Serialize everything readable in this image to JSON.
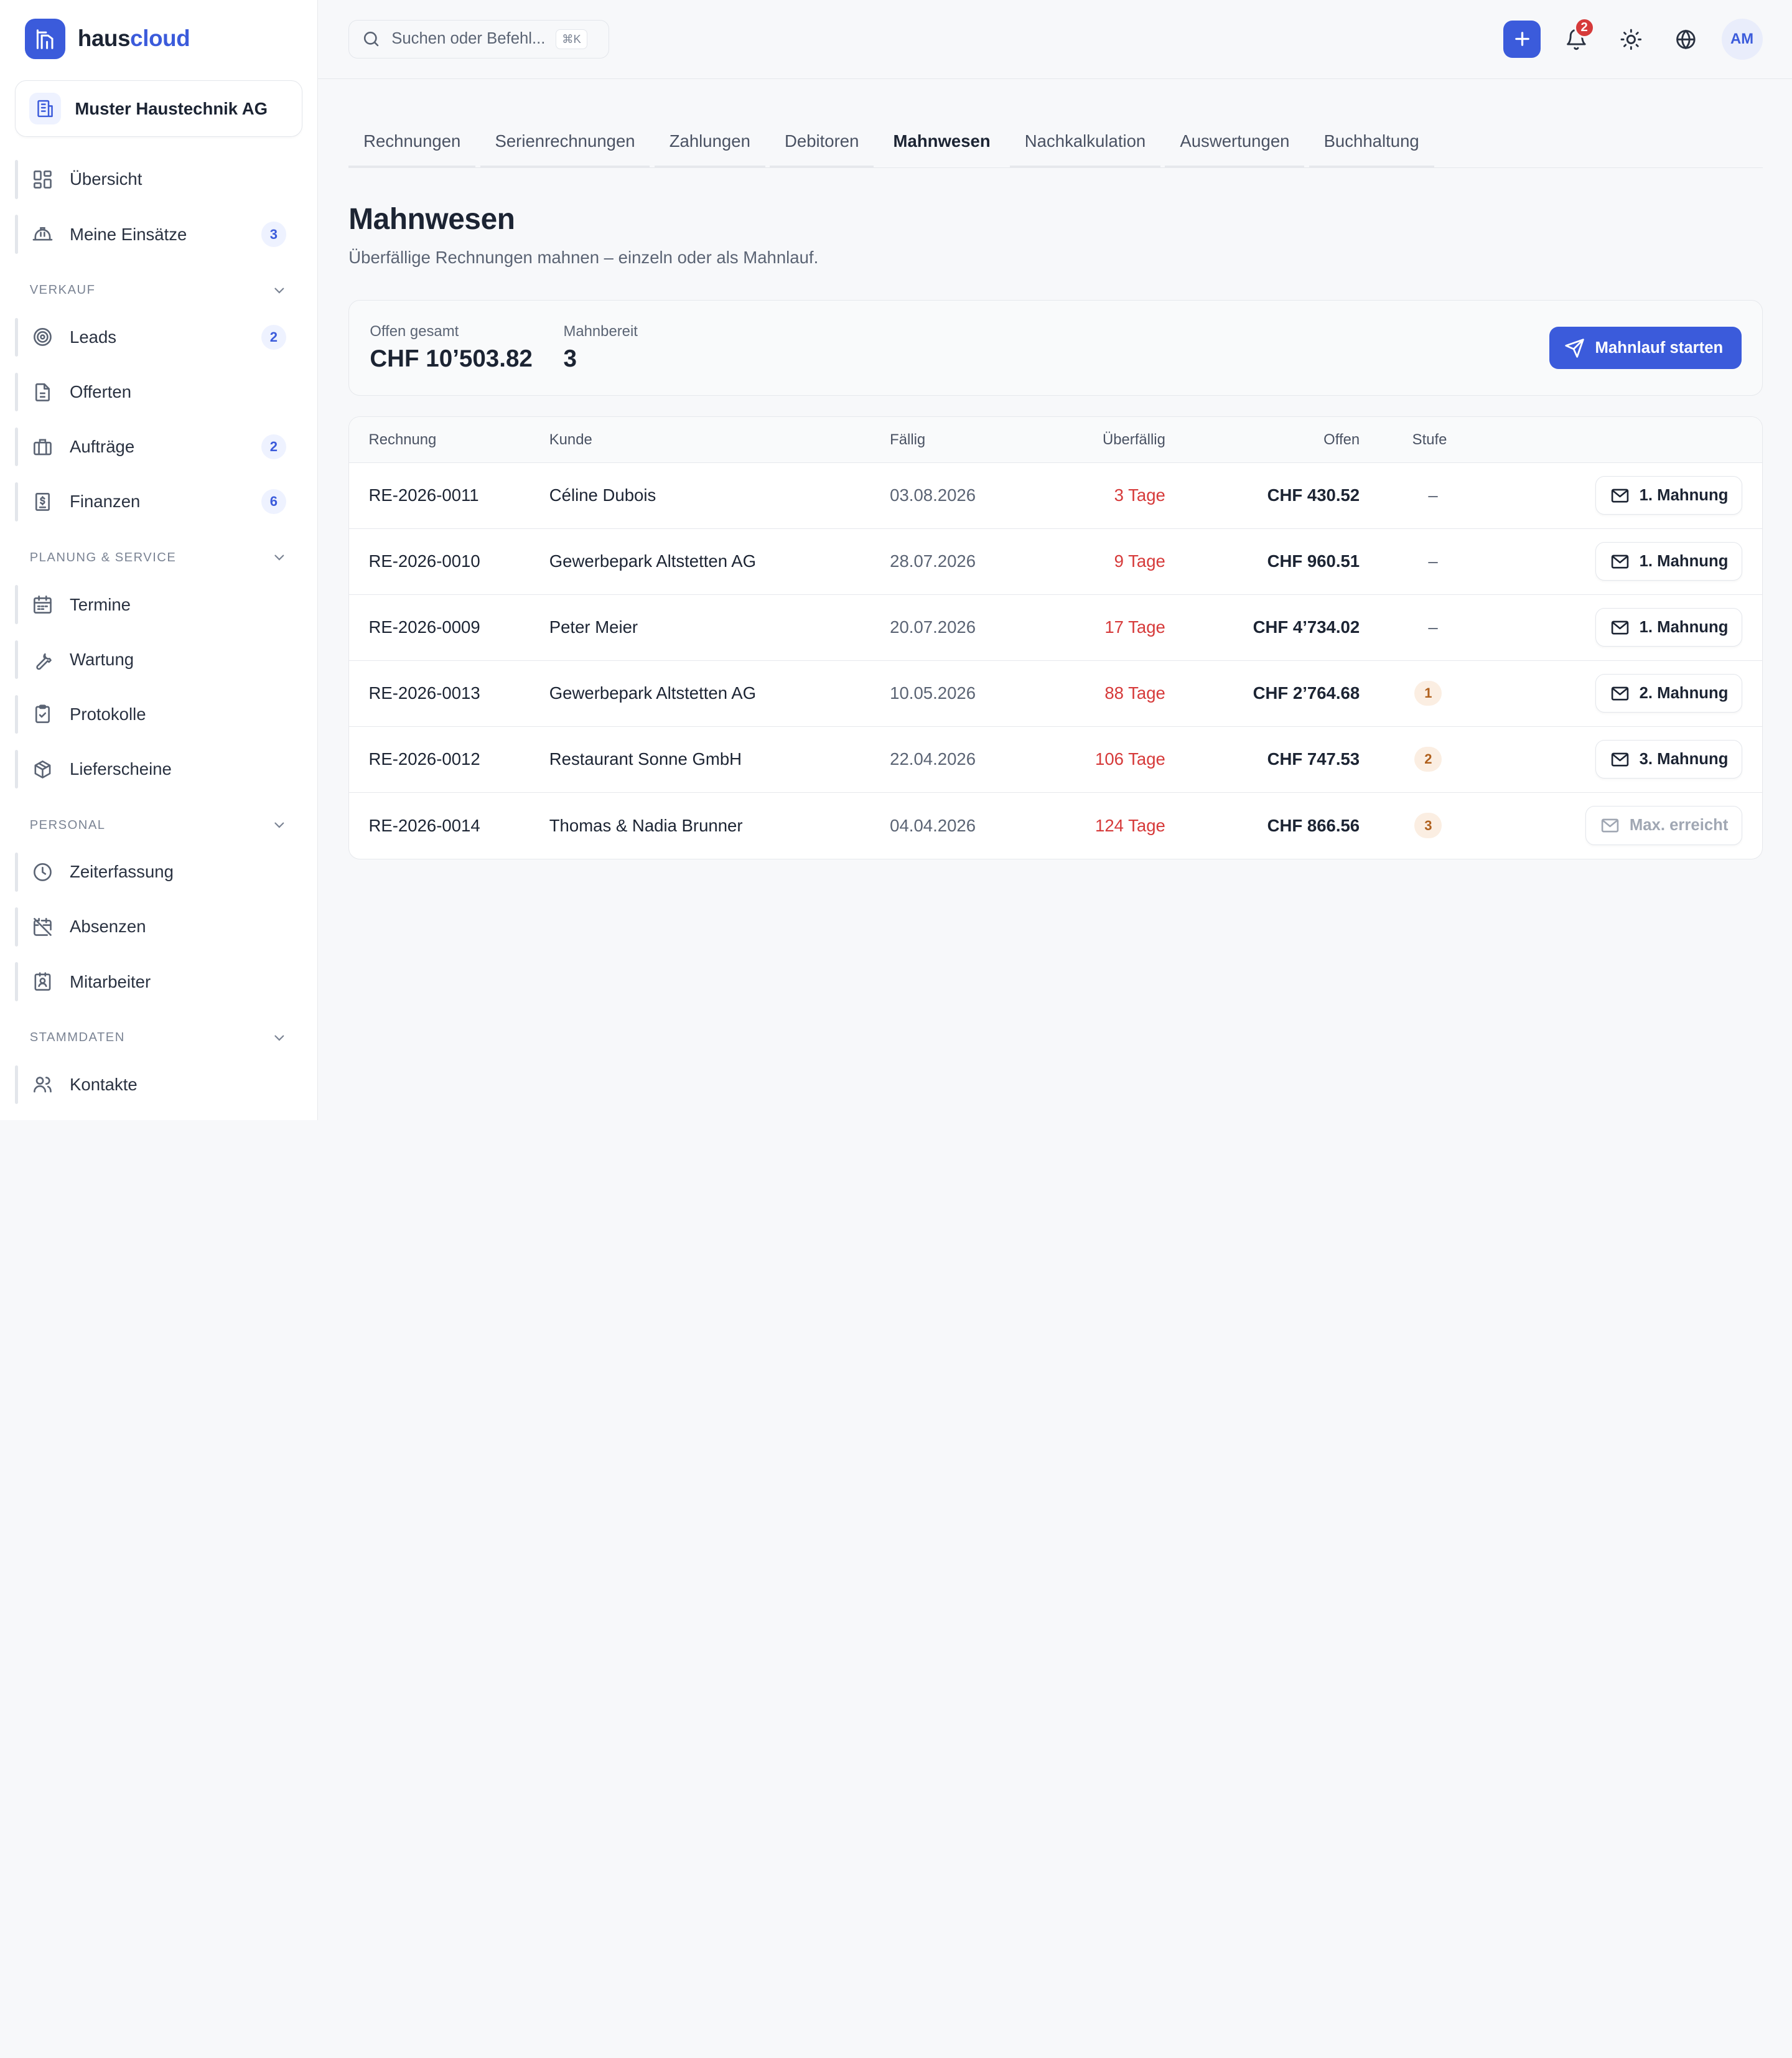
{
  "brand": {
    "part1": "haus",
    "part2": "cloud"
  },
  "company": {
    "name": "Muster Haustechnik AG"
  },
  "sidebar": {
    "top_items": [
      {
        "label": "Übersicht",
        "icon": "dashboard-icon"
      },
      {
        "label": "Meine Einsätze",
        "icon": "hardhat-icon",
        "count": "3"
      }
    ],
    "sections": [
      {
        "title": "VERKAUF",
        "items": [
          {
            "label": "Leads",
            "icon": "target-icon",
            "count": "2"
          },
          {
            "label": "Offerten",
            "icon": "document-icon"
          },
          {
            "label": "Aufträge",
            "icon": "briefcase-icon",
            "count": "2"
          },
          {
            "label": "Finanzen",
            "icon": "invoice-icon",
            "count": "6"
          }
        ]
      },
      {
        "title": "PLANUNG & SERVICE",
        "items": [
          {
            "label": "Termine",
            "icon": "calendar-icon"
          },
          {
            "label": "Wartung",
            "icon": "wrench-icon"
          },
          {
            "label": "Protokolle",
            "icon": "clipboard-check-icon"
          },
          {
            "label": "Lieferscheine",
            "icon": "package-icon"
          }
        ]
      },
      {
        "title": "PERSONAL",
        "items": [
          {
            "label": "Zeiterfassung",
            "icon": "clock-icon"
          },
          {
            "label": "Absenzen",
            "icon": "calendar-off-icon"
          },
          {
            "label": "Mitarbeiter",
            "icon": "id-badge-icon"
          }
        ]
      },
      {
        "title": "STAMMDATEN",
        "items": [
          {
            "label": "Kontakte",
            "icon": "users-icon"
          }
        ]
      }
    ]
  },
  "topbar": {
    "search_placeholder": "Suchen oder Befehl...",
    "shortcut": "⌘K",
    "notifications_count": "2",
    "avatar": "AM"
  },
  "tabs": [
    "Rechnungen",
    "Serienrechnungen",
    "Zahlungen",
    "Debitoren",
    "Mahnwesen",
    "Nachkalkulation",
    "Auswertungen",
    "Buchhaltung"
  ],
  "active_tab": "Mahnwesen",
  "page": {
    "title": "Mahnwesen",
    "subtitle": "Überfällige Rechnungen mahnen – einzeln oder als Mahnlauf."
  },
  "summary": {
    "open_label": "Offen gesamt",
    "open_value": "CHF 10’503.82",
    "ready_label": "Mahnbereit",
    "ready_value": "3",
    "run_button": "Mahnlauf starten"
  },
  "table": {
    "headers": [
      "Rechnung",
      "Kunde",
      "Fällig",
      "Überfällig",
      "Offen",
      "Stufe"
    ],
    "rows": [
      {
        "invoice": "RE-2026-0011",
        "customer": "Céline Dubois",
        "due": "03.08.2026",
        "overdue": "3 Tage",
        "open": "CHF 430.52",
        "level": "–",
        "action": "1. Mahnung",
        "enabled": true
      },
      {
        "invoice": "RE-2026-0010",
        "customer": "Gewerbepark Altstetten AG",
        "due": "28.07.2026",
        "overdue": "9 Tage",
        "open": "CHF 960.51",
        "level": "–",
        "action": "1. Mahnung",
        "enabled": true
      },
      {
        "invoice": "RE-2026-0009",
        "customer": "Peter Meier",
        "due": "20.07.2026",
        "overdue": "17 Tage",
        "open": "CHF 4’734.02",
        "level": "–",
        "action": "1. Mahnung",
        "enabled": true
      },
      {
        "invoice": "RE-2026-0013",
        "customer": "Gewerbepark Altstetten AG",
        "due": "10.05.2026",
        "overdue": "88 Tage",
        "open": "CHF 2’764.68",
        "level": "1",
        "action": "2. Mahnung",
        "enabled": true
      },
      {
        "invoice": "RE-2026-0012",
        "customer": "Restaurant Sonne GmbH",
        "due": "22.04.2026",
        "overdue": "106 Tage",
        "open": "CHF 747.53",
        "level": "2",
        "action": "3. Mahnung",
        "enabled": true
      },
      {
        "invoice": "RE-2026-0014",
        "customer": "Thomas & Nadia Brunner",
        "due": "04.04.2026",
        "overdue": "124 Tage",
        "open": "CHF 866.56",
        "level": "3",
        "action": "Max. erreicht",
        "enabled": false
      }
    ]
  },
  "colors": {
    "accent": "#3b5bdb",
    "danger": "#d63a3a",
    "level_badge": "#fbeee2"
  }
}
